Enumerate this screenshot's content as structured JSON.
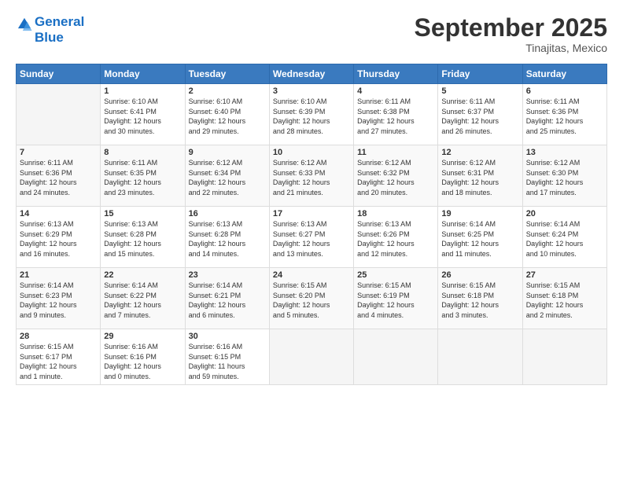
{
  "logo": {
    "line1": "General",
    "line2": "Blue"
  },
  "title": "September 2025",
  "subtitle": "Tinajitas, Mexico",
  "days_header": [
    "Sunday",
    "Monday",
    "Tuesday",
    "Wednesday",
    "Thursday",
    "Friday",
    "Saturday"
  ],
  "weeks": [
    [
      {
        "day": "",
        "info": ""
      },
      {
        "day": "1",
        "info": "Sunrise: 6:10 AM\nSunset: 6:41 PM\nDaylight: 12 hours\nand 30 minutes."
      },
      {
        "day": "2",
        "info": "Sunrise: 6:10 AM\nSunset: 6:40 PM\nDaylight: 12 hours\nand 29 minutes."
      },
      {
        "day": "3",
        "info": "Sunrise: 6:10 AM\nSunset: 6:39 PM\nDaylight: 12 hours\nand 28 minutes."
      },
      {
        "day": "4",
        "info": "Sunrise: 6:11 AM\nSunset: 6:38 PM\nDaylight: 12 hours\nand 27 minutes."
      },
      {
        "day": "5",
        "info": "Sunrise: 6:11 AM\nSunset: 6:37 PM\nDaylight: 12 hours\nand 26 minutes."
      },
      {
        "day": "6",
        "info": "Sunrise: 6:11 AM\nSunset: 6:36 PM\nDaylight: 12 hours\nand 25 minutes."
      }
    ],
    [
      {
        "day": "7",
        "info": "Sunrise: 6:11 AM\nSunset: 6:36 PM\nDaylight: 12 hours\nand 24 minutes."
      },
      {
        "day": "8",
        "info": "Sunrise: 6:11 AM\nSunset: 6:35 PM\nDaylight: 12 hours\nand 23 minutes."
      },
      {
        "day": "9",
        "info": "Sunrise: 6:12 AM\nSunset: 6:34 PM\nDaylight: 12 hours\nand 22 minutes."
      },
      {
        "day": "10",
        "info": "Sunrise: 6:12 AM\nSunset: 6:33 PM\nDaylight: 12 hours\nand 21 minutes."
      },
      {
        "day": "11",
        "info": "Sunrise: 6:12 AM\nSunset: 6:32 PM\nDaylight: 12 hours\nand 20 minutes."
      },
      {
        "day": "12",
        "info": "Sunrise: 6:12 AM\nSunset: 6:31 PM\nDaylight: 12 hours\nand 18 minutes."
      },
      {
        "day": "13",
        "info": "Sunrise: 6:12 AM\nSunset: 6:30 PM\nDaylight: 12 hours\nand 17 minutes."
      }
    ],
    [
      {
        "day": "14",
        "info": "Sunrise: 6:13 AM\nSunset: 6:29 PM\nDaylight: 12 hours\nand 16 minutes."
      },
      {
        "day": "15",
        "info": "Sunrise: 6:13 AM\nSunset: 6:28 PM\nDaylight: 12 hours\nand 15 minutes."
      },
      {
        "day": "16",
        "info": "Sunrise: 6:13 AM\nSunset: 6:28 PM\nDaylight: 12 hours\nand 14 minutes."
      },
      {
        "day": "17",
        "info": "Sunrise: 6:13 AM\nSunset: 6:27 PM\nDaylight: 12 hours\nand 13 minutes."
      },
      {
        "day": "18",
        "info": "Sunrise: 6:13 AM\nSunset: 6:26 PM\nDaylight: 12 hours\nand 12 minutes."
      },
      {
        "day": "19",
        "info": "Sunrise: 6:14 AM\nSunset: 6:25 PM\nDaylight: 12 hours\nand 11 minutes."
      },
      {
        "day": "20",
        "info": "Sunrise: 6:14 AM\nSunset: 6:24 PM\nDaylight: 12 hours\nand 10 minutes."
      }
    ],
    [
      {
        "day": "21",
        "info": "Sunrise: 6:14 AM\nSunset: 6:23 PM\nDaylight: 12 hours\nand 9 minutes."
      },
      {
        "day": "22",
        "info": "Sunrise: 6:14 AM\nSunset: 6:22 PM\nDaylight: 12 hours\nand 7 minutes."
      },
      {
        "day": "23",
        "info": "Sunrise: 6:14 AM\nSunset: 6:21 PM\nDaylight: 12 hours\nand 6 minutes."
      },
      {
        "day": "24",
        "info": "Sunrise: 6:15 AM\nSunset: 6:20 PM\nDaylight: 12 hours\nand 5 minutes."
      },
      {
        "day": "25",
        "info": "Sunrise: 6:15 AM\nSunset: 6:19 PM\nDaylight: 12 hours\nand 4 minutes."
      },
      {
        "day": "26",
        "info": "Sunrise: 6:15 AM\nSunset: 6:18 PM\nDaylight: 12 hours\nand 3 minutes."
      },
      {
        "day": "27",
        "info": "Sunrise: 6:15 AM\nSunset: 6:18 PM\nDaylight: 12 hours\nand 2 minutes."
      }
    ],
    [
      {
        "day": "28",
        "info": "Sunrise: 6:15 AM\nSunset: 6:17 PM\nDaylight: 12 hours\nand 1 minute."
      },
      {
        "day": "29",
        "info": "Sunrise: 6:16 AM\nSunset: 6:16 PM\nDaylight: 12 hours\nand 0 minutes."
      },
      {
        "day": "30",
        "info": "Sunrise: 6:16 AM\nSunset: 6:15 PM\nDaylight: 11 hours\nand 59 minutes."
      },
      {
        "day": "",
        "info": ""
      },
      {
        "day": "",
        "info": ""
      },
      {
        "day": "",
        "info": ""
      },
      {
        "day": "",
        "info": ""
      }
    ]
  ]
}
